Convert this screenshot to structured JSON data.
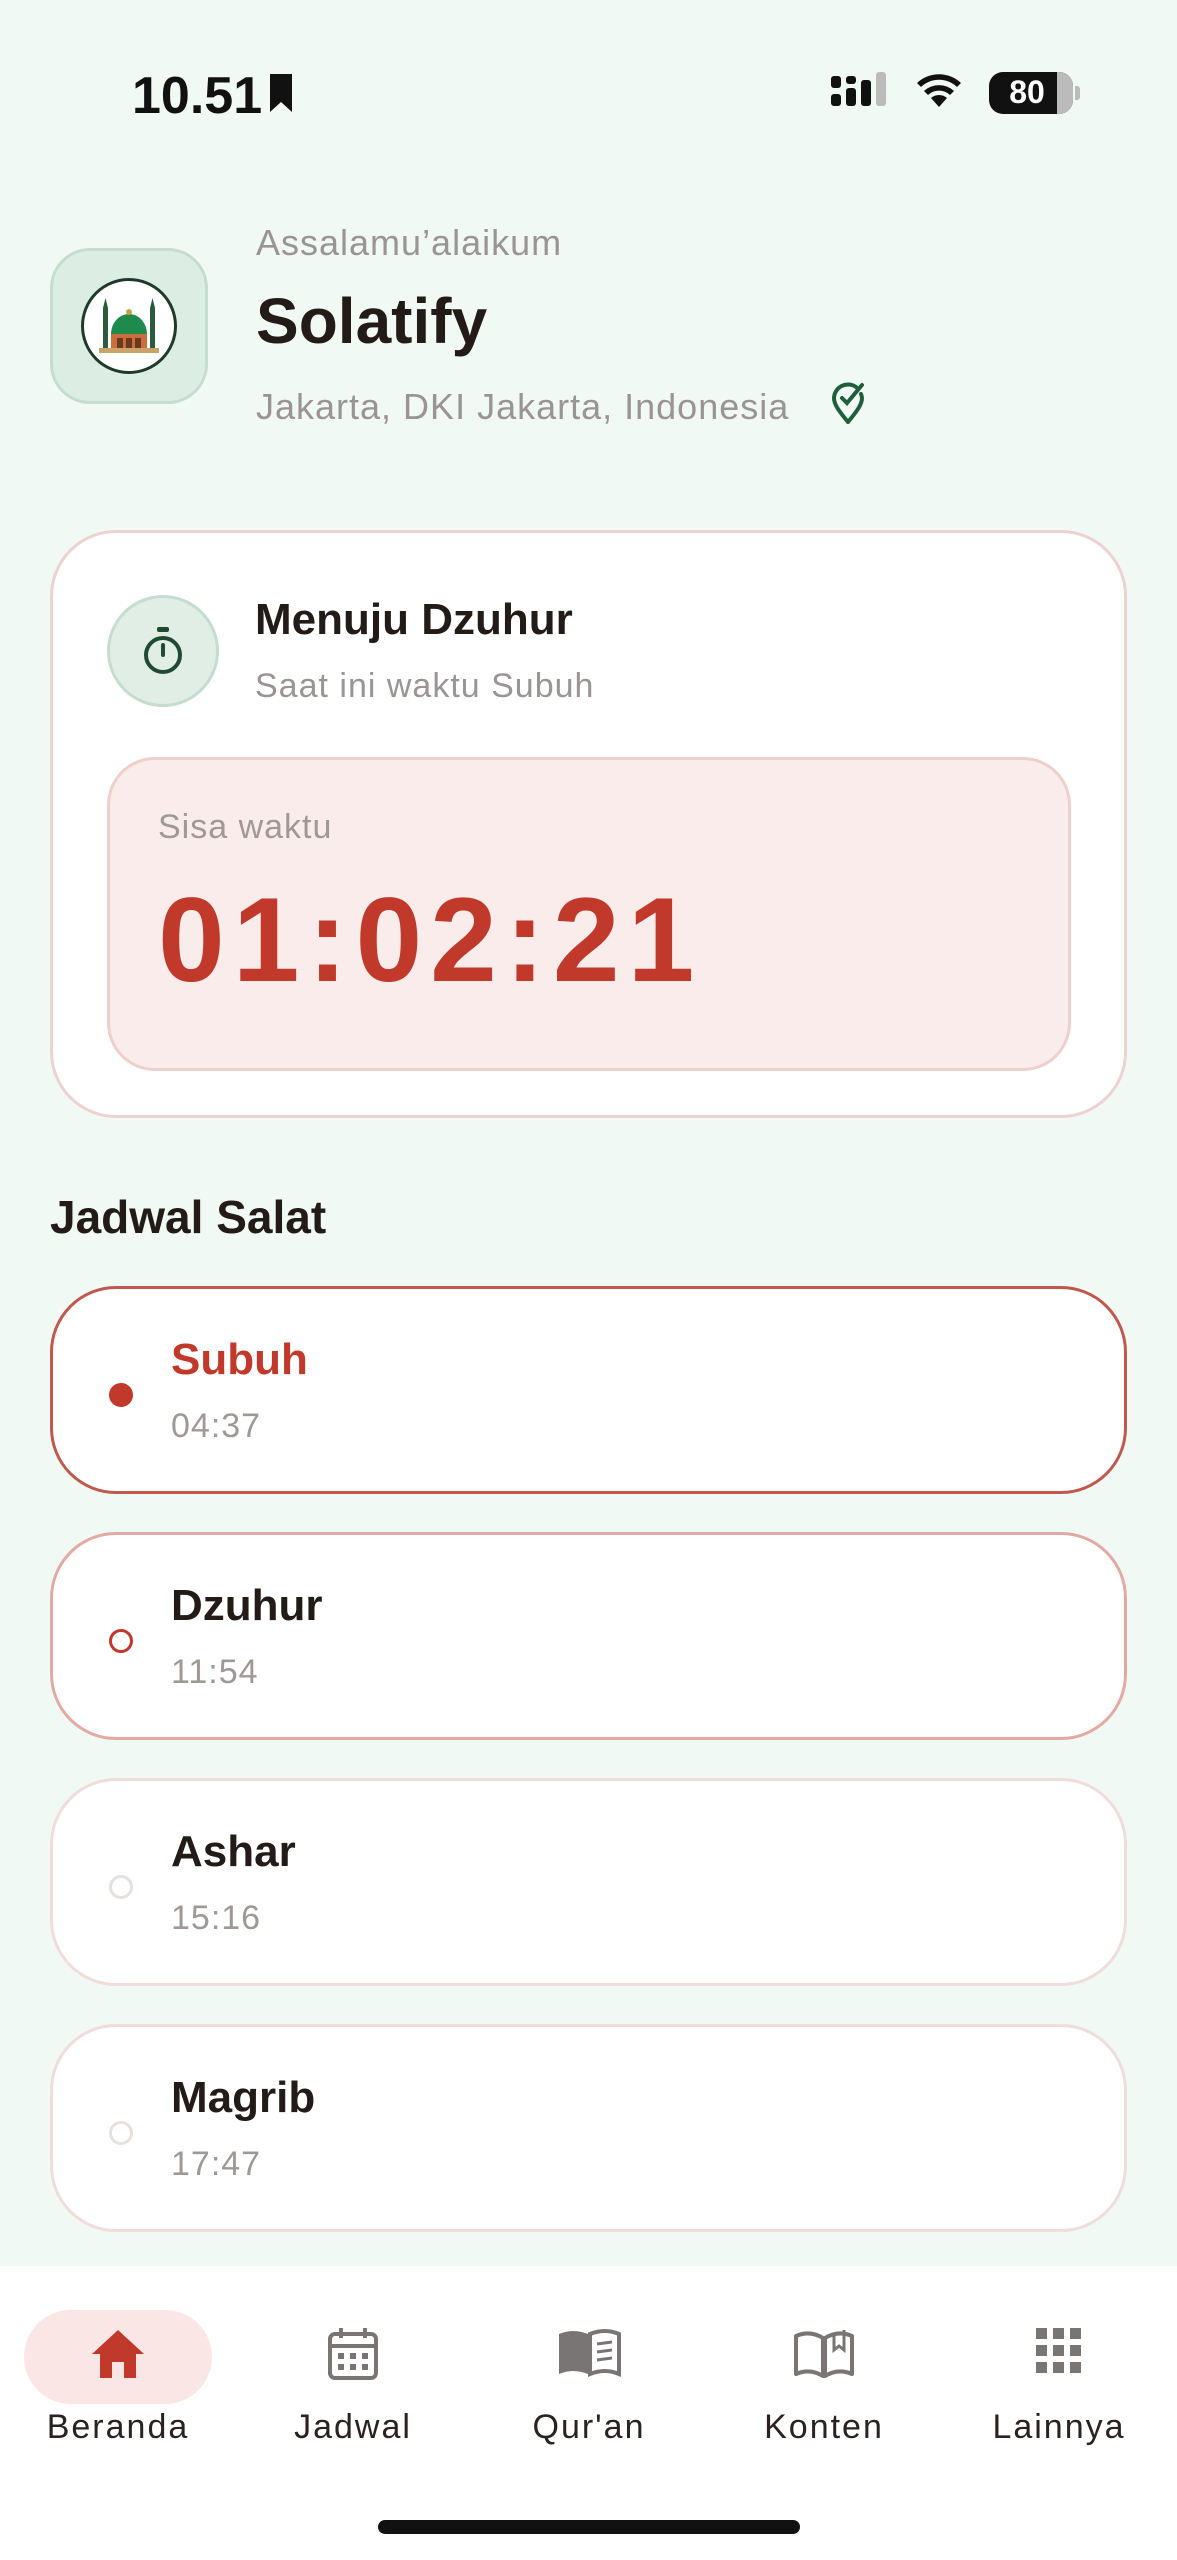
{
  "status_bar": {
    "time": "10.51",
    "battery": "80",
    "icons": [
      "bookmark-icon",
      "cellular-signal-icon",
      "wifi-icon",
      "battery-icon"
    ]
  },
  "header": {
    "greeting": "Assalamu’alaikum",
    "app_title": "Solatify",
    "location": "Jakarta, DKI Jakarta, Indonesia"
  },
  "countdown": {
    "next_prayer": "Menuju Dzuhur",
    "current_prayer": "Saat ini waktu Subuh",
    "remaining_label": "Sisa waktu",
    "remaining_time": "01:02:21"
  },
  "schedule": {
    "title": "Jadwal Salat",
    "prayers": [
      {
        "name": "Subuh",
        "time": "04:37",
        "state": "active"
      },
      {
        "name": "Dzuhur",
        "time": "11:54",
        "state": "next"
      },
      {
        "name": "Ashar",
        "time": "15:16",
        "state": "upcoming"
      },
      {
        "name": "Magrib",
        "time": "17:47",
        "state": "upcoming"
      }
    ]
  },
  "nav": {
    "items": [
      {
        "label": "Beranda",
        "icon": "home-icon",
        "active": true
      },
      {
        "label": "Jadwal",
        "icon": "calendar-icon",
        "active": false
      },
      {
        "label": "Qur'an",
        "icon": "book-icon",
        "active": false
      },
      {
        "label": "Konten",
        "icon": "open-book-icon",
        "active": false
      },
      {
        "label": "Lainnya",
        "icon": "grid-icon",
        "active": false
      }
    ]
  },
  "colors": {
    "accent": "#c0392b",
    "background": "#f1f9f4",
    "primary_green": "#1f5e3b"
  }
}
